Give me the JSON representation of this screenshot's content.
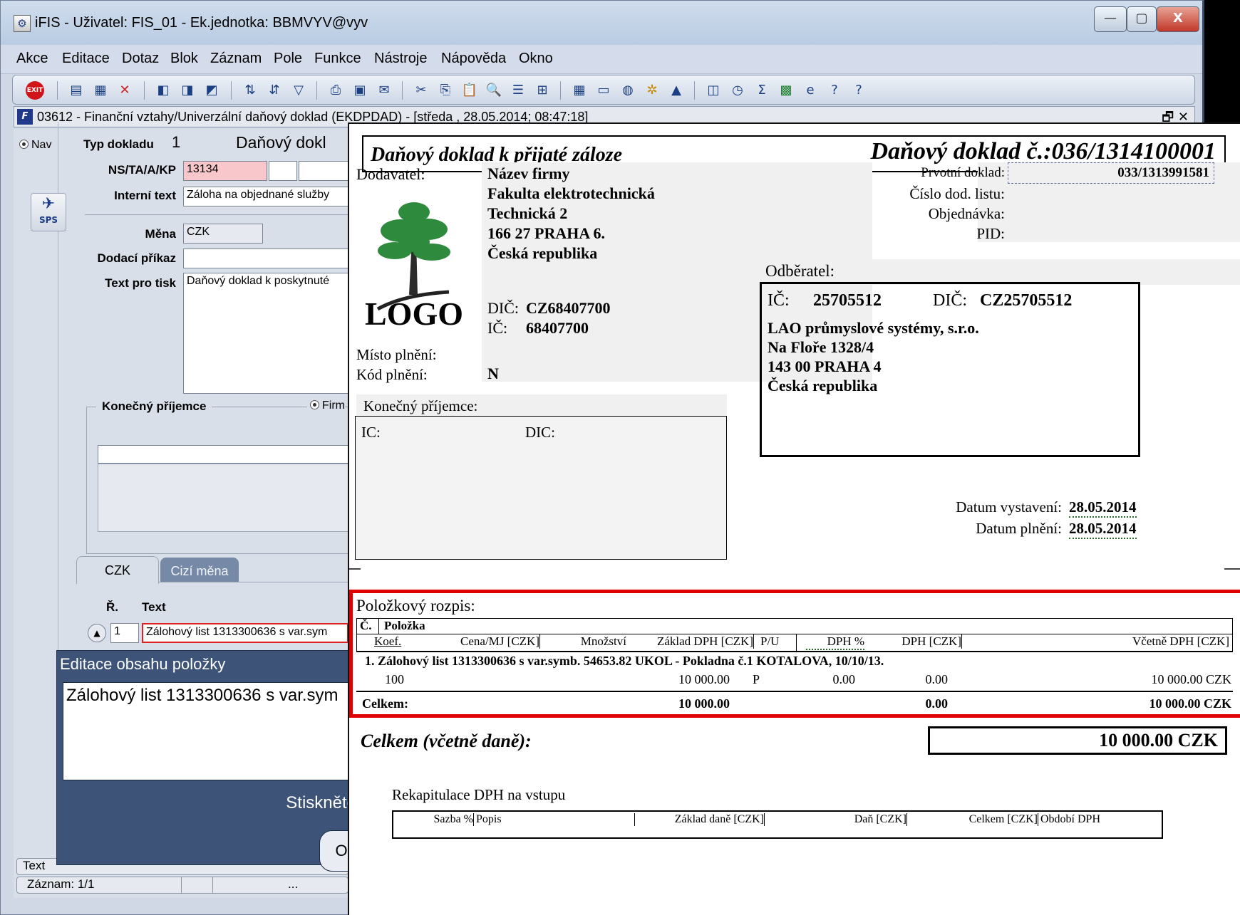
{
  "window": {
    "title": "iFIS - Uživatel: FIS_01 - Ek.jednotka: BBMVYV@vyv",
    "min": "—",
    "max": "▢",
    "close": "X"
  },
  "menu": [
    "Akce",
    "Editace",
    "Dotaz",
    "Blok",
    "Záznam",
    "Pole",
    "Funkce",
    "Nástroje",
    "Nápověda",
    "Okno"
  ],
  "subwindow": {
    "title": "03612 - Finanční vztahy/Univerzální daňový doklad (EKDPDAD) - [středa , 28.05.2014; 08:47:18]",
    "controls": "🗗 ✕"
  },
  "form": {
    "nav_label": "Nav",
    "typ_label": "Typ dokladu",
    "typ_value": "1",
    "typ_name": "Daňový dokl",
    "ns_label": "NS/TA/A/KP",
    "ns_value": "13134",
    "interni_label": "Interní text",
    "interni_value": "Záloha na objednané služby",
    "mena_label": "Měna",
    "mena_value": "CZK",
    "dodaci_label": "Dodací příkaz",
    "dodaci_value": "",
    "tisk_label": "Text pro tisk",
    "tisk_value": "Daňový doklad k poskytnuté",
    "sps_label": "SPS",
    "konecny_label": "Konečný příjemce",
    "firm_label": "Firm",
    "tab_czk": "CZK",
    "tab_cizi": "Cizí měna",
    "col_r": "Ř.",
    "col_text": "Text",
    "row_num": "1",
    "row_text": "Zálohový list 1313300636 s var.sym"
  },
  "popup": {
    "title": "Editace obsahu položky",
    "text": "Zálohový list 1313300636 s var.sym",
    "hint": "Stiskněte",
    "button": "O"
  },
  "status": {
    "text_label": "Text",
    "record": "Záznam: 1/1",
    "dots": "..."
  },
  "invoice": {
    "heading_left": "Daňový doklad k přijaté záloze",
    "heading_right": "Daňový doklad č.:036/1314100001",
    "dodavatel_label": "Dodavatel:",
    "supplier": [
      "Název firmy",
      "Fakulta elektrotechnická",
      "Technická 2",
      "166 27 PRAHA 6.",
      "Česká republika"
    ],
    "logo_text": "LOGO",
    "dic_label": "DIČ:",
    "dic_value": "CZ68407700",
    "ic_label": "IČ:",
    "ic_value": "68407700",
    "prvotni_label": "Prvotní doklad:",
    "prvotni_value": "033/1313991581",
    "cislo_label": "Číslo dod. listu:",
    "objednavka_label": "Objednávka:",
    "pid_label": "PID:",
    "odberatel_label": "Odběratel:",
    "customer_ic_label": "IČ:",
    "customer_ic": "25705512",
    "customer_dic_label": "DIČ:",
    "customer_dic": "CZ25705512",
    "customer": [
      "LAO průmyslové systémy, s.r.o.",
      "Na Floře 1328/4",
      "143 00 PRAHA 4",
      "Česká republika"
    ],
    "misto_label": "Místo plnění:",
    "kod_label": "Kód plnění:",
    "kod_value": "N",
    "konecny_label": "Konečný příjemce:",
    "kp_ic_label": "IC:",
    "kp_dic_label": "DIC:",
    "datum_vystaveni_label": "Datum vystavení:",
    "datum_vystaveni": "28.05.2014",
    "datum_plneni_label": "Datum plnění:",
    "datum_plneni": "28.05.2014",
    "polozky_heading": "Položkový rozpis:",
    "table_h1": [
      "Č.",
      "Položka"
    ],
    "table_h2": [
      "Koef.",
      "Cena/MJ [CZK]",
      "Množství",
      "Základ DPH [CZK]",
      "P/U",
      "DPH %",
      "DPH [CZK]",
      "Včetně DPH [CZK]"
    ],
    "item_desc": "1.  Zálohový list 1313300636 s var.symb. 54653.82 UKOL - Pokladna č.1 KOTALOVA, 10/10/13.",
    "item_koef": "100",
    "item_zaklad": "10 000.00",
    "item_pu": "P",
    "item_dph_pct": "0.00",
    "item_dph": "0.00",
    "item_vcetne": "10 000.00 CZK",
    "celkem_label": "Celkem:",
    "celkem_zaklad": "10 000.00",
    "celkem_dph": "0.00",
    "celkem_vcetne": "10 000.00 CZK",
    "celkem_dane_label": "Celkem (včetně daně):",
    "celkem_dane_value": "10 000.00 CZK",
    "rekap_heading": "Rekapitulace DPH na vstupu",
    "rekap_cols": [
      "Sazba %",
      "Popis",
      "Základ daně [CZK]",
      "Daň [CZK]",
      "Celkem [CZK]",
      "Období DPH"
    ],
    "highlight_color": "#e00000"
  }
}
